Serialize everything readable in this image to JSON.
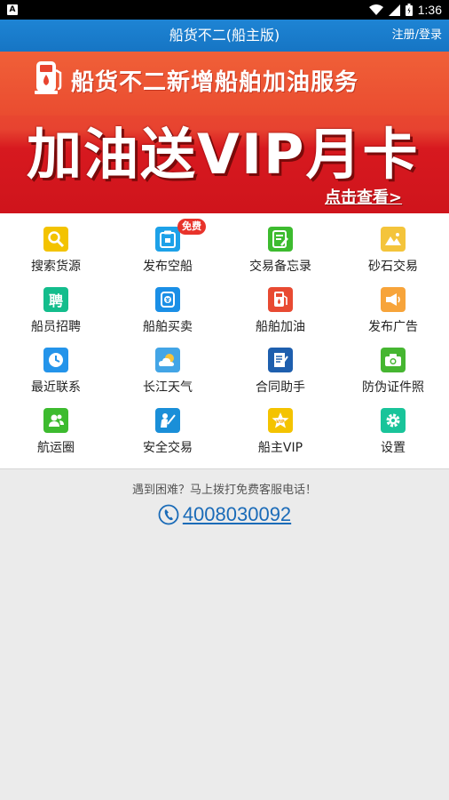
{
  "status_bar": {
    "time": "1:36",
    "notification_glyph": "A"
  },
  "app_bar": {
    "title": "船货不二(船主版)",
    "login_label": "注册/登录"
  },
  "banner": {
    "subtitle": "船货不二新增船舶加油服务",
    "headline": "加油送VIP月卡",
    "cta": "点击查看>"
  },
  "menu": {
    "items": [
      {
        "label": "搜索货源",
        "icon": "search-icon",
        "color": "#f3c300"
      },
      {
        "label": "发布空船",
        "icon": "clipboard-icon",
        "color": "#1da1e8",
        "badge": "免费"
      },
      {
        "label": "交易备忘录",
        "icon": "notes-icon",
        "color": "#3dbb2f"
      },
      {
        "label": "砂石交易",
        "icon": "mountain-icon",
        "color": "#f4c43b"
      },
      {
        "label": "船员招聘",
        "icon": "recruit-icon",
        "color": "#13bd8c",
        "glyph": "聘"
      },
      {
        "label": "船舶买卖",
        "icon": "trade-icon",
        "color": "#1a8fe6"
      },
      {
        "label": "船舶加油",
        "icon": "fuel-pump-icon",
        "color": "#e84a32"
      },
      {
        "label": "发布广告",
        "icon": "megaphone-icon",
        "color": "#f7a43a"
      },
      {
        "label": "最近联系",
        "icon": "clock-icon",
        "color": "#2494ea"
      },
      {
        "label": "长江天气",
        "icon": "weather-icon",
        "color": "#43a5e6"
      },
      {
        "label": "合同助手",
        "icon": "contract-icon",
        "color": "#1e5fae"
      },
      {
        "label": "防伪证件照",
        "icon": "camera-icon",
        "color": "#46b631"
      },
      {
        "label": "航运圈",
        "icon": "group-icon",
        "color": "#3dbb2f"
      },
      {
        "label": "安全交易",
        "icon": "handshake-icon",
        "color": "#1a8fd8"
      },
      {
        "label": "船主VIP",
        "icon": "vip-star-icon",
        "color": "#f4c300"
      },
      {
        "label": "设置",
        "icon": "gear-icon",
        "color": "#19c49a"
      }
    ]
  },
  "support": {
    "prompt": "遇到困难？马上拨打免费客服电话！",
    "phone": "4008030092"
  }
}
